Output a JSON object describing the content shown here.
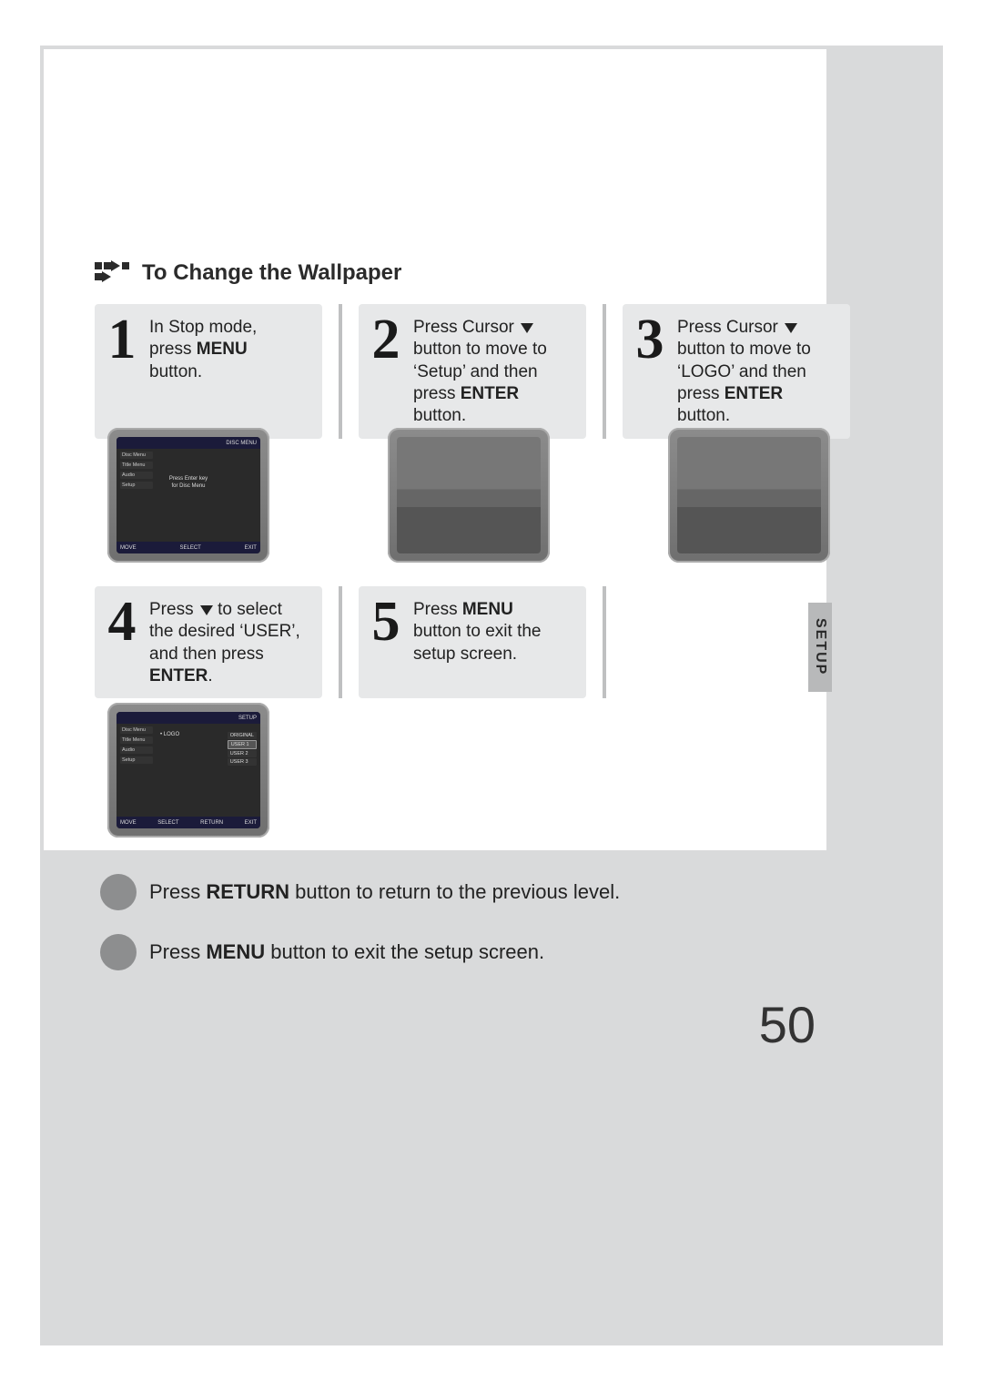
{
  "heading": "To Change the Wallpaper",
  "steps": [
    {
      "num": "1",
      "lines": [
        "In Stop mode,",
        "press <b>MENU</b>",
        "button."
      ]
    },
    {
      "num": "2",
      "lines": [
        "Press Cursor ▼",
        "button to move to",
        "'Setup' and then",
        "press <b>ENTER</b> button."
      ]
    },
    {
      "num": "3",
      "lines": [
        "Press Cursor ▼",
        "button to move to",
        "'LOGO' and then",
        "press <b>ENTER</b> button."
      ]
    },
    {
      "num": "4",
      "lines": [
        "Press ▼ to select",
        "the desired 'USER',",
        "and then press",
        "<b>ENTER</b>."
      ]
    },
    {
      "num": "5",
      "lines": [
        "Press <b>MENU</b>",
        "button to exit the",
        "setup screen."
      ]
    }
  ],
  "osd1": {
    "top_right": "DISC MENU",
    "side": [
      "Disc Menu",
      "Title Menu",
      "Audio",
      "Setup"
    ],
    "mid": [
      "Press Enter key",
      "for Disc Menu"
    ],
    "bot": [
      "MOVE",
      "SELECT",
      "EXIT"
    ]
  },
  "osd4": {
    "top_right": "SETUP",
    "side": [
      "Disc Menu",
      "Title Menu",
      "Audio",
      "Setup"
    ],
    "col_label": "LOGO",
    "options": [
      "ORIGINAL",
      "USER 1",
      "USER 2",
      "USER 3"
    ],
    "selected": "USER 1",
    "bot": [
      "MOVE",
      "SELECT",
      "RETURN",
      "EXIT"
    ]
  },
  "side_tab": "SETUP",
  "notes": [
    "Press <b>RETURN</b> button to return to the previous level.",
    "Press <b>MENU</b> button to exit the setup screen."
  ],
  "page_number": "50"
}
